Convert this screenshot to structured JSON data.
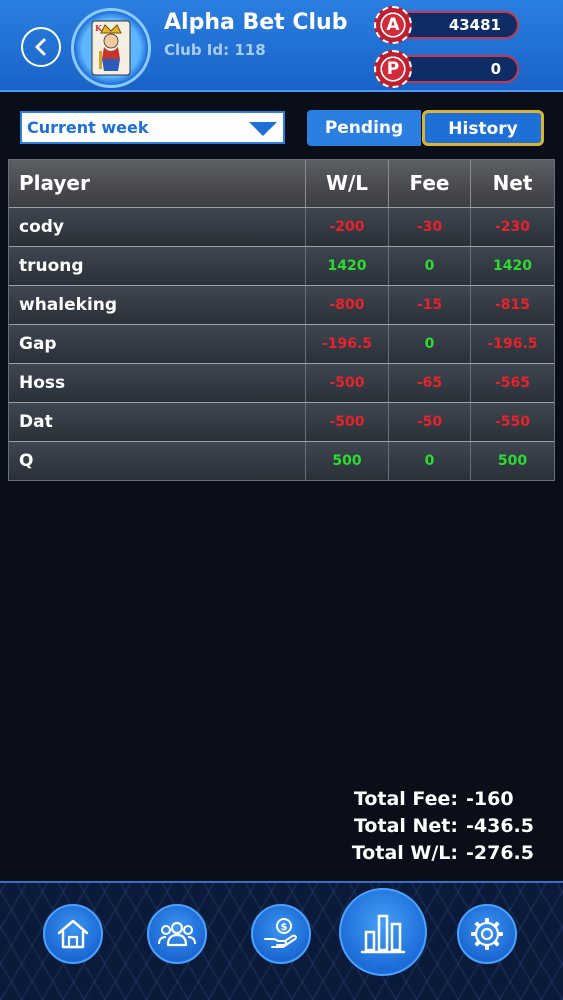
{
  "header": {
    "club_name": "Alpha Bet Club",
    "club_id": "Club Id: 118",
    "balance_a_label": "A",
    "balance_a": "43481",
    "balance_p_label": "P",
    "balance_p": "0"
  },
  "filter": {
    "week": "Current week",
    "tab_pending": "Pending",
    "tab_history": "History",
    "active_tab": "History"
  },
  "table": {
    "headers": [
      "Player",
      "W/L",
      "Fee",
      "Net"
    ],
    "rows": [
      {
        "player": "cody",
        "wl": "-200",
        "fee": "-30",
        "net": "-230"
      },
      {
        "player": "truong",
        "wl": "1420",
        "fee": "0",
        "net": "1420"
      },
      {
        "player": "whaleking",
        "wl": "-800",
        "fee": "-15",
        "net": "-815"
      },
      {
        "player": "Gap",
        "wl": "-196.5",
        "fee": "0",
        "net": "-196.5"
      },
      {
        "player": "Hoss",
        "wl": "-500",
        "fee": "-65",
        "net": "-565"
      },
      {
        "player": "Dat",
        "wl": "-500",
        "fee": "-50",
        "net": "-550"
      },
      {
        "player": "Q",
        "wl": "500",
        "fee": "0",
        "net": "500"
      }
    ]
  },
  "totals": {
    "fee_label": "Total Fee:",
    "fee": "-160",
    "net_label": "Total Net:",
    "net": "-436.5",
    "wl_label": "Total W/L:",
    "wl": "-276.5"
  },
  "nav": {
    "items": [
      "home-icon",
      "members-icon",
      "money-hand-icon",
      "stats-icon",
      "settings-icon"
    ],
    "active": "stats-icon"
  },
  "colors": {
    "negative": "#e8222a",
    "positive": "#2bdc2f",
    "accent": "#2a7fe0",
    "tab_highlight": "#d8b433"
  }
}
